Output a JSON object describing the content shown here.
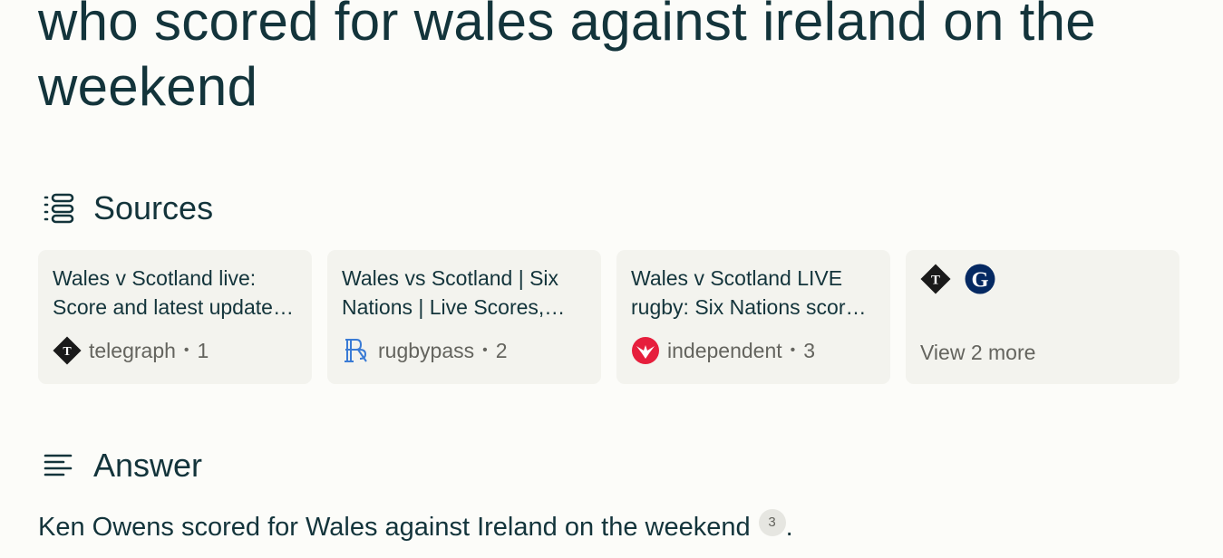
{
  "query": "who scored for wales against ireland on the weekend",
  "sources": {
    "heading": "Sources",
    "icon": "sources-list-icon",
    "cards": [
      {
        "title": "Wales v Scotland live: Score and latest updates from the Six Nations",
        "site": "telegraph",
        "index": "1",
        "favicon": "telegraph-favicon"
      },
      {
        "title": "Wales vs Scotland | Six Nations | Live Scores, Stats",
        "site": "rugbypass",
        "index": "2",
        "favicon": "rugbypass-favicon"
      },
      {
        "title": "Wales v Scotland LIVE rugby: Six Nations score and updates",
        "site": "independent",
        "index": "3",
        "favicon": "independent-favicon"
      }
    ],
    "more": {
      "label": "View 2 more",
      "favicons": [
        "telegraph-favicon",
        "guardian-favicon"
      ]
    }
  },
  "answer": {
    "heading": "Answer",
    "icon": "answer-lines-icon",
    "text": "Ken Owens scored for Wales against Ireland on the weekend",
    "citation": "3",
    "end_punct": "."
  },
  "colors": {
    "background": "#fcfcf9",
    "text": "#13343b",
    "card": "#f3f3ee",
    "muted": "#64645e",
    "independent_red": "#e61e3c",
    "rugbypass_blue": "#3a7bd5",
    "guardian_navy": "#052962"
  }
}
